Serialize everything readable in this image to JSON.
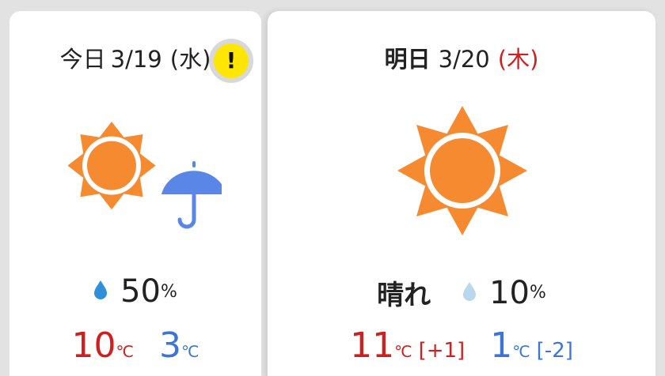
{
  "today": {
    "day_label": "今日",
    "date": "3/19",
    "weekday": "(水)",
    "alert_symbol": "!",
    "icon": "sun-with-umbrella-icon",
    "precip_chance": "50",
    "precip_unit": "%",
    "high": "10",
    "high_unit": "℃",
    "low": "3",
    "low_unit": "℃"
  },
  "tomorrow": {
    "day_label": "明日",
    "date": "3/20",
    "weekday": "(木)",
    "icon": "sun-icon",
    "condition": "晴れ",
    "precip_chance": "10",
    "precip_unit": "%",
    "high": "11",
    "high_unit": "℃",
    "high_diff": "[+1]",
    "low": "1",
    "low_unit": "℃",
    "low_diff": "[-2]"
  },
  "colors": {
    "sun": "#f58a31",
    "umbrella": "#5a86e8",
    "drop_active": "#2f8fd8",
    "drop_light": "#b9d8ec",
    "high_temp": "#cf2020",
    "low_temp": "#3c74d8",
    "alert": "#ffe600"
  }
}
